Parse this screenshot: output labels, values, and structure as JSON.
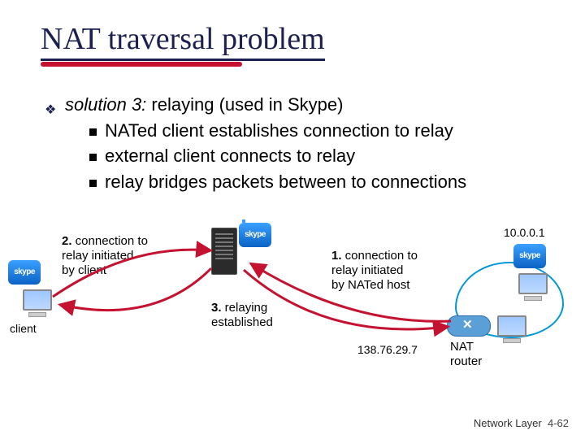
{
  "title": "NAT traversal problem",
  "bullets": {
    "lead_italic": "solution 3:",
    "lead_rest": " relaying (used in Skype)",
    "sub1": "NATed client establishes connection to relay",
    "sub2": "external client connects to relay",
    "sub3": "relay bridges packets between to connections"
  },
  "diagram": {
    "step2_bold": "2.",
    "step2_text": " connection to\nrelay initiated\nby client",
    "step3_bold": "3.",
    "step3_text": " relaying\nestablished",
    "step1_bold": "1.",
    "step1_text": " connection to\nrelay initiated\nby NATed host",
    "client_label": "client",
    "nat_router_label": "NAT\nrouter",
    "ip_lan": "10.0.0.1",
    "ip_wan": "138.76.29.7"
  },
  "footer": {
    "section": "Network Layer",
    "page": "4-62"
  },
  "icons": {
    "skype": "skype"
  }
}
